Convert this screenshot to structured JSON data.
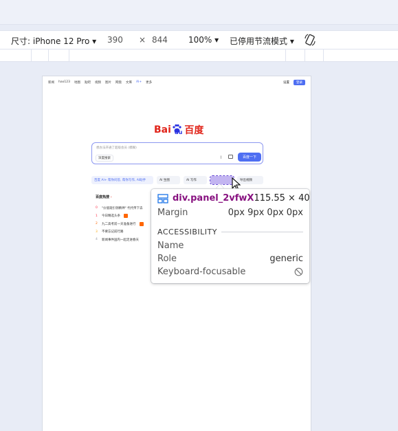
{
  "toolbar": {
    "device_label": "尺寸: iPhone 12 Pro",
    "width": "390",
    "times": "×",
    "height": "844",
    "zoom": "100%",
    "throttle": "已停用节流模式"
  },
  "page": {
    "nav": [
      "新闻",
      "hao123",
      "地图",
      "贴吧",
      "视频",
      "图片",
      "网盘",
      "文库",
      "AI+",
      "更多"
    ],
    "nav_active_index": 8,
    "settings": "设置",
    "login": "登录",
    "logo_latin_a": "Bai",
    "logo_latin_b": "du",
    "logo_cn": "百度",
    "search_placeholder": "想办法开通了超级会员 (模糊)",
    "deep_think": "深度搜索",
    "search_button": "百度一下",
    "chips": [
      {
        "label": "百度 AI+ 帮你问答, 帮你写作, AI助手",
        "kind": "ai"
      },
      {
        "label": "AI 生图",
        "kind": "normal"
      },
      {
        "label": "AI 写作",
        "kind": "normal"
      },
      {
        "label": "",
        "kind": "hl"
      },
      {
        "label": "导出视频",
        "kind": "normal"
      }
    ],
    "hot_title": "百度热搜",
    "hot_list": [
      {
        "rank": "0",
        "text": "\"价值观引领精神\" 代代传下去"
      },
      {
        "rank": "1",
        "text": "今日精选头条"
      },
      {
        "rank": "2",
        "text": "九二高考前一天准备进行"
      },
      {
        "rank": "3",
        "text": "不要忘记前行路"
      },
      {
        "rank": "4",
        "text": "新闻事件国内一起走进春天"
      }
    ]
  },
  "inspector": {
    "element_name": "div.panel_2vfwX",
    "dimensions": "115.55 × 40",
    "margin_label": "Margin",
    "margin_value": "0px 9px 0px 0px",
    "section_title": "ACCESSIBILITY",
    "name_label": "Name",
    "name_value": "",
    "role_label": "Role",
    "role_value": "generic",
    "focus_label": "Keyboard-focusable"
  },
  "colors": {
    "accent": "#4e6ef2",
    "logo_red": "#e1251b",
    "logo_blue": "#2932e1",
    "selector_purple": "#881280"
  }
}
